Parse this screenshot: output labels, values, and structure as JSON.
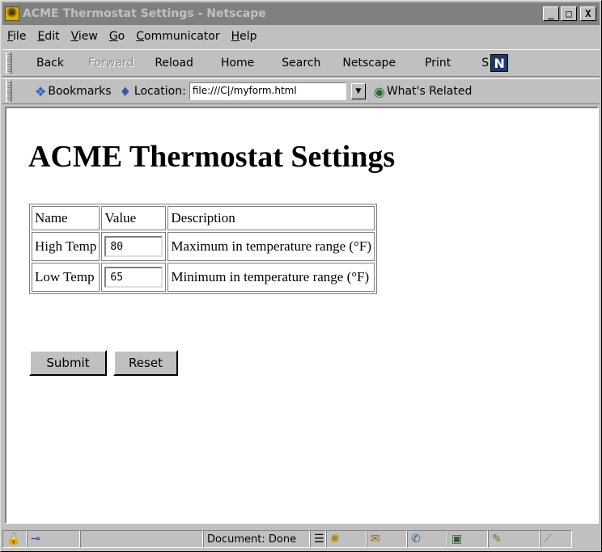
{
  "window": {
    "title": "ACME Thermostat Settings - Netscape",
    "minimize_glyph": "_",
    "maximize_glyph": "□",
    "close_glyph": "X"
  },
  "menubar": {
    "items": [
      {
        "label": "File",
        "key": "F",
        "rest": "ile"
      },
      {
        "label": "Edit",
        "key": "E",
        "rest": "dit"
      },
      {
        "label": "View",
        "key": "V",
        "rest": "iew"
      },
      {
        "label": "Go",
        "key": "G",
        "rest": "o"
      },
      {
        "label": "Communicator",
        "key": "C",
        "rest": "ommunicator"
      },
      {
        "label": "Help",
        "key": "H",
        "rest": "elp"
      }
    ]
  },
  "navigation_toolbar": {
    "back": "Back",
    "forward": "Forward",
    "reload": "Reload",
    "home": "Home",
    "search": "Search",
    "netscape": "Netscape",
    "print": "Print",
    "security": "S",
    "logo": "N"
  },
  "location_toolbar": {
    "bookmarks": "Bookmarks",
    "location_label": "Location:",
    "location_value": "file:///C|/myform.html",
    "whats_related": "What's Related"
  },
  "page": {
    "title": "ACME Thermostat Settings",
    "table": {
      "headers": [
        "Name",
        "Value",
        "Description"
      ],
      "rows": [
        {
          "name": "High Temp",
          "value": "80",
          "description": "Maximum in temperature range (°F)"
        },
        {
          "name": "Low Temp",
          "value": "65",
          "description": "Minimum in temperature range (°F)"
        }
      ]
    },
    "submit_label": "Submit",
    "reset_label": "Reset"
  },
  "statusbar": {
    "status_text": "Document: Done"
  }
}
